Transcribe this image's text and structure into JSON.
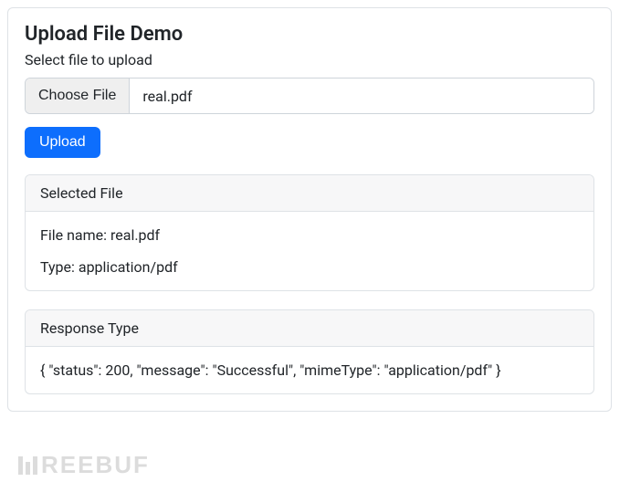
{
  "title": "Upload File Demo",
  "subtitle": "Select file to upload",
  "file_input": {
    "choose_label": "Choose File",
    "selected_name": "real.pdf"
  },
  "upload_button": "Upload",
  "selected_panel": {
    "header": "Selected File",
    "file_name_line": "File name: real.pdf",
    "type_line": "Type: application/pdf"
  },
  "response_panel": {
    "header": "Response Type",
    "body": "{ \"status\": 200, \"message\": \"Successful\", \"mimeType\": \"application/pdf\" }"
  },
  "watermark": "REEBUF"
}
